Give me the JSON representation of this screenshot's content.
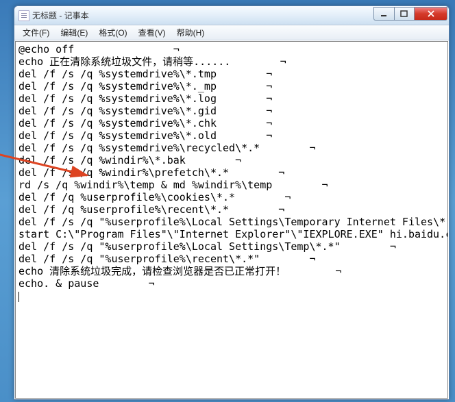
{
  "window": {
    "title": "无标题 - 记事本"
  },
  "menu": {
    "file": "文件(F)",
    "edit": "编辑(E)",
    "format": "格式(O)",
    "view": "查看(V)",
    "help": "帮助(H)"
  },
  "content": {
    "text": "@echo off                ¬\necho 正在清除系统垃圾文件，请稍等......        ¬\ndel /f /s /q %systemdrive%\\*.tmp        ¬\ndel /f /s /q %systemdrive%\\*._mp        ¬\ndel /f /s /q %systemdrive%\\*.log        ¬\ndel /f /s /q %systemdrive%\\*.gid        ¬\ndel /f /s /q %systemdrive%\\*.chk        ¬\ndel /f /s /q %systemdrive%\\*.old        ¬\ndel /f /s /q %systemdrive%\\recycled\\*.*        ¬\ndel /f /s /q %windir%\\*.bak        ¬\ndel /f /s /q %windir%\\prefetch\\*.*        ¬\nrd /s /q %windir%\\temp & md %windir%\\temp        ¬\ndel /f /q %userprofile%\\cookies\\*.*        ¬\ndel /f /q %userprofile%\\recent\\*.*        ¬\ndel /f /s /q \"%userprofile%\\Local Settings\\Temporary Internet Files\\*.*\"        ¬\nstart C:\\\"Program Files\"\\\"Internet Explorer\"\\\"IEXPLORE.EXE\" hi.baidu.com/csns\ndel /f /s /q \"%userprofile%\\Local Settings\\Temp\\*.*\"        ¬\ndel /f /s /q \"%userprofile%\\recent\\*.*\"        ¬\necho 清除系统垃圾完成，请检查浏览器是否已正常打开！        ¬\necho. & pause        ¬\n"
  }
}
